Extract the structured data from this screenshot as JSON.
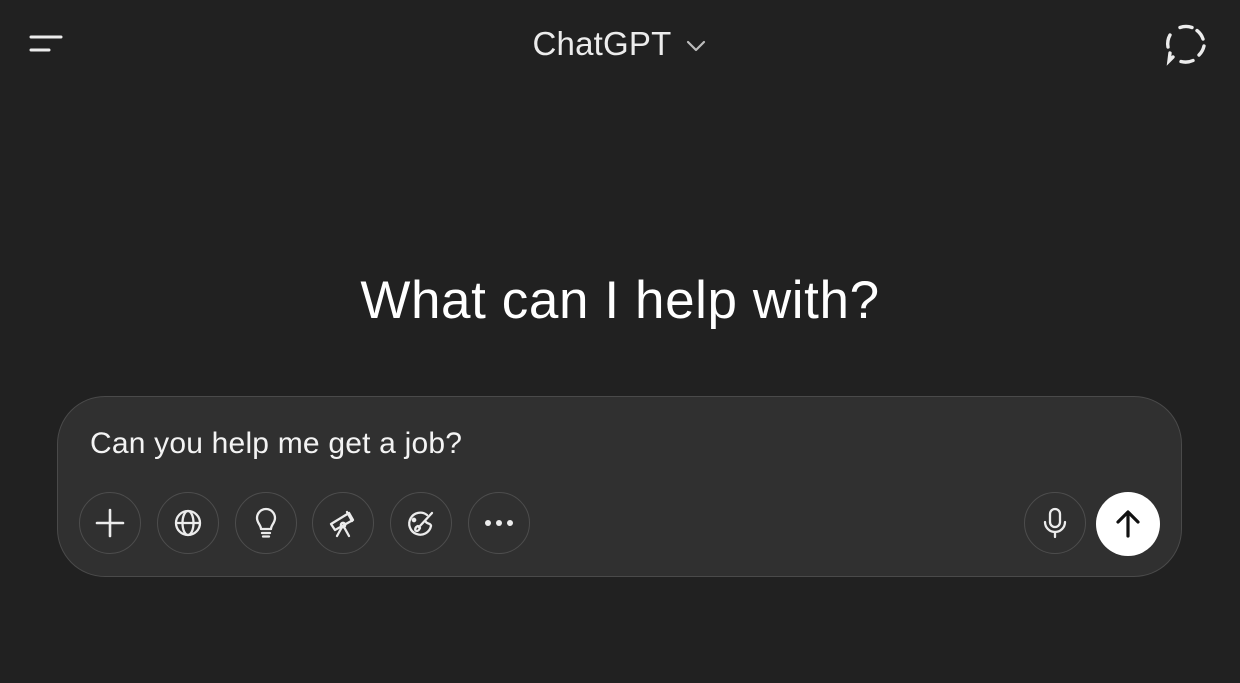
{
  "header": {
    "title": "ChatGPT",
    "icons": {
      "menu": "sidebar-menu-icon",
      "model_selector": "chevron-down-icon",
      "temporary_chat": "temporary-chat-icon"
    }
  },
  "main": {
    "heading": "What can I help with?"
  },
  "composer": {
    "value": "Can you help me get a job?",
    "tools": [
      {
        "name": "add",
        "icon": "plus-icon"
      },
      {
        "name": "search",
        "icon": "globe-icon"
      },
      {
        "name": "reason",
        "icon": "lightbulb-icon"
      },
      {
        "name": "deep-research",
        "icon": "telescope-icon"
      },
      {
        "name": "create-image",
        "icon": "paint-palette-icon"
      },
      {
        "name": "more",
        "icon": "more-horizontal-icon"
      }
    ],
    "voice_icon": "microphone-icon",
    "send_icon": "arrow-up-icon"
  },
  "colors": {
    "background": "#212121",
    "composer": "#303030",
    "composer_border": "#4a4a4a",
    "text": "#ececec",
    "send_button": "#ffffff"
  }
}
